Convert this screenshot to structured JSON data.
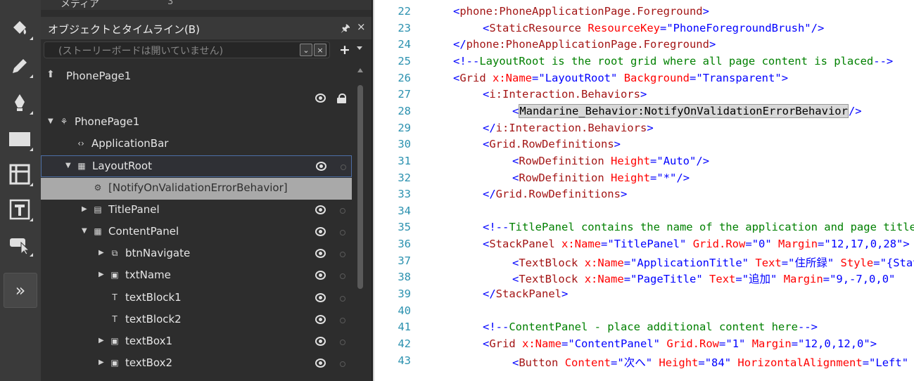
{
  "tools": {
    "items": [
      "paint-bucket-icon",
      "pencil-icon",
      "pen-icon",
      "rectangle-icon",
      "grid-icon",
      "text-icon",
      "pointer-icon"
    ],
    "expand_label": "»"
  },
  "objects_panel": {
    "media_tab": {
      "label": "メディア",
      "count": "3"
    },
    "title": "オブジェクトとタイムライン(B)",
    "storyboard_placeholder": "(ストーリーボードは開いていません)",
    "scope": "PhonePage1",
    "tree": [
      {
        "label": "PhonePage1",
        "icon": "page-node-icon",
        "arrow": "▼",
        "level": 0,
        "eye": false
      },
      {
        "label": "ApplicationBar",
        "icon": "code-brackets-icon",
        "arrow": "",
        "level": 1,
        "eye": false
      },
      {
        "label": "LayoutRoot",
        "icon": "grid-icon",
        "arrow": "▼",
        "level": 1,
        "eye": true,
        "state": "selected"
      },
      {
        "label": "[NotifyOnValidationErrorBehavior]",
        "icon": "gear-icon",
        "arrow": "",
        "level": 2,
        "eye": false,
        "state": "highlight"
      },
      {
        "label": "TitlePanel",
        "icon": "stackpanel-icon",
        "arrow": "▶",
        "level": 2,
        "eye": true
      },
      {
        "label": "ContentPanel",
        "icon": "grid-icon",
        "arrow": "▼",
        "level": 2,
        "eye": true
      },
      {
        "label": "btnNavigate",
        "icon": "button-icon",
        "arrow": "▶",
        "level": 3,
        "eye": true
      },
      {
        "label": "txtName",
        "icon": "textbox-icon",
        "arrow": "▶",
        "level": 3,
        "eye": true
      },
      {
        "label": "textBlock1",
        "icon": "textblock-icon",
        "arrow": "",
        "level": 3,
        "eye": true
      },
      {
        "label": "textBlock2",
        "icon": "textblock-icon",
        "arrow": "",
        "level": 3,
        "eye": true
      },
      {
        "label": "textBox1",
        "icon": "textbox-icon",
        "arrow": "▶",
        "level": 3,
        "eye": true
      },
      {
        "label": "textBox2",
        "icon": "textbox-icon",
        "arrow": "▶",
        "level": 3,
        "eye": true
      }
    ]
  },
  "code_editor": {
    "lines": [
      {
        "num": "22",
        "indent": 1,
        "tokens": [
          [
            "pu",
            "<"
          ],
          [
            "el",
            "phone:PhoneApplicationPage.Foreground"
          ],
          [
            "pu",
            ">"
          ]
        ]
      },
      {
        "num": "23",
        "indent": 2,
        "tokens": [
          [
            "pu",
            "<"
          ],
          [
            "el",
            "StaticResource"
          ],
          [
            "pu",
            " "
          ],
          [
            "at",
            "ResourceKey"
          ],
          [
            "pu",
            "="
          ],
          [
            "va",
            "\"PhoneForegroundBrush\""
          ],
          [
            "pu",
            "/>"
          ]
        ]
      },
      {
        "num": "24",
        "indent": 1,
        "tokens": [
          [
            "pu",
            "</"
          ],
          [
            "el",
            "phone:PhoneApplicationPage.Foreground"
          ],
          [
            "pu",
            ">"
          ]
        ]
      },
      {
        "num": "25",
        "indent": 1,
        "tokens": [
          [
            "pu",
            "<!--"
          ],
          [
            "cm",
            "LayoutRoot is the root grid where all page content is placed"
          ],
          [
            "pu",
            "-->"
          ]
        ]
      },
      {
        "num": "26",
        "indent": 1,
        "tokens": [
          [
            "pu",
            "<"
          ],
          [
            "el",
            "Grid"
          ],
          [
            "pu",
            " "
          ],
          [
            "at",
            "x:Name"
          ],
          [
            "pu",
            "="
          ],
          [
            "va",
            "\"LayoutRoot\""
          ],
          [
            "pu",
            " "
          ],
          [
            "at",
            "Background"
          ],
          [
            "pu",
            "="
          ],
          [
            "va",
            "\"Transparent\""
          ],
          [
            "pu",
            ">"
          ]
        ]
      },
      {
        "num": "27",
        "indent": 2,
        "tokens": [
          [
            "pu",
            "<"
          ],
          [
            "el",
            "i:Interaction.Behaviors"
          ],
          [
            "pu",
            ">"
          ]
        ]
      },
      {
        "num": "28",
        "indent": 3,
        "tokens": [
          [
            "pu",
            "<"
          ],
          [
            "hl",
            "Mandarine_Behavior:NotifyOnValidationErrorBehavior"
          ],
          [
            "pu",
            "/>"
          ]
        ]
      },
      {
        "num": "29",
        "indent": 2,
        "tokens": [
          [
            "pu",
            "</"
          ],
          [
            "el",
            "i:Interaction.Behaviors"
          ],
          [
            "pu",
            ">"
          ]
        ]
      },
      {
        "num": "30",
        "indent": 2,
        "tokens": [
          [
            "pu",
            "<"
          ],
          [
            "el",
            "Grid.RowDefinitions"
          ],
          [
            "pu",
            ">"
          ]
        ]
      },
      {
        "num": "31",
        "indent": 3,
        "tokens": [
          [
            "pu",
            "<"
          ],
          [
            "el",
            "RowDefinition"
          ],
          [
            "pu",
            " "
          ],
          [
            "at",
            "Height"
          ],
          [
            "pu",
            "="
          ],
          [
            "va",
            "\"Auto\""
          ],
          [
            "pu",
            "/>"
          ]
        ]
      },
      {
        "num": "32",
        "indent": 3,
        "tokens": [
          [
            "pu",
            "<"
          ],
          [
            "el",
            "RowDefinition"
          ],
          [
            "pu",
            " "
          ],
          [
            "at",
            "Height"
          ],
          [
            "pu",
            "="
          ],
          [
            "va",
            "\"*\""
          ],
          [
            "pu",
            "/>"
          ]
        ]
      },
      {
        "num": "33",
        "indent": 2,
        "tokens": [
          [
            "pu",
            "</"
          ],
          [
            "el",
            "Grid.RowDefinitions"
          ],
          [
            "pu",
            ">"
          ]
        ]
      },
      {
        "num": "34",
        "indent": 0,
        "tokens": []
      },
      {
        "num": "35",
        "indent": 2,
        "tokens": [
          [
            "pu",
            "<!--"
          ],
          [
            "cm",
            "TitlePanel contains the name of the application and page title"
          ],
          [
            "pu",
            "-->"
          ]
        ]
      },
      {
        "num": "36",
        "indent": 2,
        "tokens": [
          [
            "pu",
            "<"
          ],
          [
            "el",
            "StackPanel"
          ],
          [
            "pu",
            " "
          ],
          [
            "at",
            "x:Name"
          ],
          [
            "pu",
            "="
          ],
          [
            "va",
            "\"TitlePanel\""
          ],
          [
            "pu",
            " "
          ],
          [
            "at",
            "Grid.Row"
          ],
          [
            "pu",
            "="
          ],
          [
            "va",
            "\"0\""
          ],
          [
            "pu",
            " "
          ],
          [
            "at",
            "Margin"
          ],
          [
            "pu",
            "="
          ],
          [
            "va",
            "\"12,17,0,28\""
          ],
          [
            "pu",
            ">"
          ]
        ]
      },
      {
        "num": "37",
        "indent": 3,
        "tokens": [
          [
            "pu",
            "<"
          ],
          [
            "el",
            "TextBlock"
          ],
          [
            "pu",
            " "
          ],
          [
            "at",
            "x:Name"
          ],
          [
            "pu",
            "="
          ],
          [
            "va",
            "\"ApplicationTitle\""
          ],
          [
            "pu",
            " "
          ],
          [
            "at",
            "Text"
          ],
          [
            "pu",
            "="
          ],
          [
            "va",
            "\"住所録\""
          ],
          [
            "pu",
            " "
          ],
          [
            "at",
            "Style"
          ],
          [
            "pu",
            "="
          ],
          [
            "va",
            "\"{StaticResource}\""
          ]
        ]
      },
      {
        "num": "38",
        "indent": 3,
        "tokens": [
          [
            "pu",
            "<"
          ],
          [
            "el",
            "TextBlock"
          ],
          [
            "pu",
            " "
          ],
          [
            "at",
            "x:Name"
          ],
          [
            "pu",
            "="
          ],
          [
            "va",
            "\"PageTitle\""
          ],
          [
            "pu",
            " "
          ],
          [
            "at",
            "Text"
          ],
          [
            "pu",
            "="
          ],
          [
            "va",
            "\"追加\""
          ],
          [
            "pu",
            " "
          ],
          [
            "at",
            "Margin"
          ],
          [
            "pu",
            "="
          ],
          [
            "va",
            "\"9,-7,0,0\""
          ]
        ]
      },
      {
        "num": "39",
        "indent": 2,
        "tokens": [
          [
            "pu",
            "</"
          ],
          [
            "el",
            "StackPanel"
          ],
          [
            "pu",
            ">"
          ]
        ]
      },
      {
        "num": "40",
        "indent": 0,
        "tokens": []
      },
      {
        "num": "41",
        "indent": 2,
        "tokens": [
          [
            "pu",
            "<!--"
          ],
          [
            "cm",
            "ContentPanel - place additional content here"
          ],
          [
            "pu",
            "-->"
          ]
        ]
      },
      {
        "num": "42",
        "indent": 2,
        "tokens": [
          [
            "pu",
            "<"
          ],
          [
            "el",
            "Grid"
          ],
          [
            "pu",
            " "
          ],
          [
            "at",
            "x:Name"
          ],
          [
            "pu",
            "="
          ],
          [
            "va",
            "\"ContentPanel\""
          ],
          [
            "pu",
            " "
          ],
          [
            "at",
            "Grid.Row"
          ],
          [
            "pu",
            "="
          ],
          [
            "va",
            "\"1\""
          ],
          [
            "pu",
            " "
          ],
          [
            "at",
            "Margin"
          ],
          [
            "pu",
            "="
          ],
          [
            "va",
            "\"12,0,12,0\""
          ],
          [
            "pu",
            ">"
          ]
        ]
      },
      {
        "num": "43",
        "indent": 3,
        "tokens": [
          [
            "pu",
            "<"
          ],
          [
            "el",
            "Button"
          ],
          [
            "pu",
            " "
          ],
          [
            "at",
            "Content"
          ],
          [
            "pu",
            "="
          ],
          [
            "va",
            "\"次へ\""
          ],
          [
            "pu",
            " "
          ],
          [
            "at",
            "Height"
          ],
          [
            "pu",
            "="
          ],
          [
            "va",
            "\"84\""
          ],
          [
            "pu",
            " "
          ],
          [
            "at",
            "HorizontalAlignment"
          ],
          [
            "pu",
            "="
          ],
          [
            "va",
            "\"Left\""
          ]
        ]
      }
    ]
  }
}
